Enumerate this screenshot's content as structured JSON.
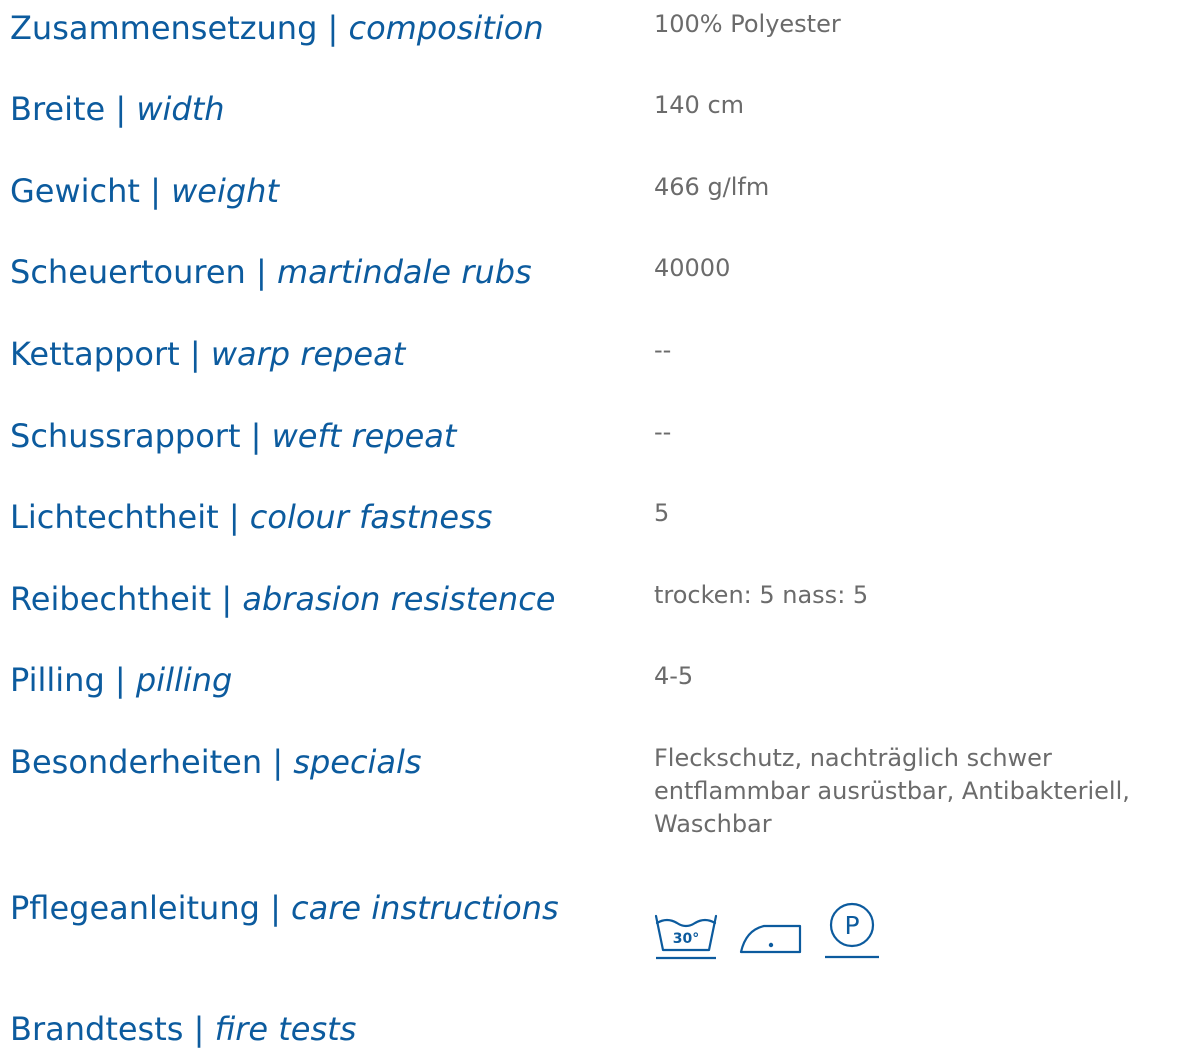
{
  "colors": {
    "label": "#0c5b9e",
    "value": "#6b6b6b"
  },
  "specs": [
    {
      "label_de": "Zusammensetzung",
      "label_en": "composition",
      "value": "100% Polyester"
    },
    {
      "label_de": "Breite",
      "label_en": "width",
      "value": "140 cm"
    },
    {
      "label_de": "Gewicht",
      "label_en": "weight",
      "value": "466 g/lfm"
    },
    {
      "label_de": "Scheuertouren",
      "label_en": "martindale rubs",
      "value": "40000"
    },
    {
      "label_de": "Kettapport",
      "label_en": "warp repeat",
      "value": "--"
    },
    {
      "label_de": "Schussrapport",
      "label_en": "weft repeat",
      "value": "--"
    },
    {
      "label_de": "Lichtechtheit",
      "label_en": "colour fastness",
      "value": "5"
    },
    {
      "label_de": "Reibechtheit",
      "label_en": "abrasion resistence",
      "value": "trocken: 5 nass: 5"
    },
    {
      "label_de": "Pilling",
      "label_en": "pilling",
      "value": "4-5"
    },
    {
      "label_de": "Besonderheiten",
      "label_en": "specials",
      "value": "Fleckschutz, nachträglich schwer entflammbar ausrüstbar, Antibakteriell, Waschbar"
    }
  ],
  "care": {
    "label_de": "Pflegeanleitung",
    "label_en": "care instructions",
    "icons": [
      {
        "name": "wash-30-icon",
        "text": "30°"
      },
      {
        "name": "iron-low-icon"
      },
      {
        "name": "dry-clean-p-icon",
        "text": "P"
      }
    ]
  },
  "fire": {
    "label_de": "Brandtests",
    "label_en": "fire tests"
  },
  "separator": " | "
}
